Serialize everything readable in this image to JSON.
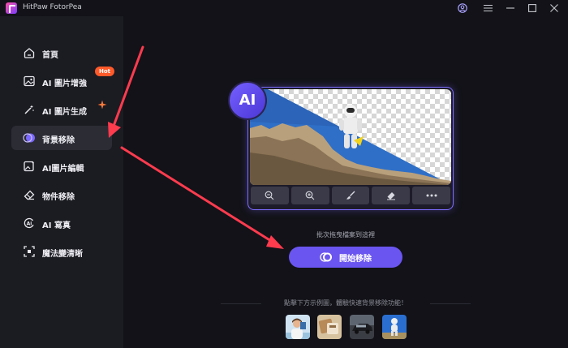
{
  "app": {
    "title": "HitPaw FotorPea"
  },
  "titlebar": {
    "icons": [
      "account-icon",
      "menu-icon",
      "minimize-icon",
      "maximize-icon",
      "close-icon"
    ]
  },
  "sidebar": {
    "items": [
      {
        "label": "首頁",
        "icon": "home-icon"
      },
      {
        "label": "AI 圖片增強",
        "icon": "image-enhance-icon"
      },
      {
        "label": "AI 圖片生成",
        "icon": "magic-wand-icon"
      },
      {
        "label": "背景移除",
        "icon": "background-remove-icon",
        "active": true
      },
      {
        "label": "AI圖片編輯",
        "icon": "image-edit-icon"
      },
      {
        "label": "物件移除",
        "icon": "eraser-icon"
      },
      {
        "label": "AI 寫真",
        "icon": "ai-portrait-icon"
      },
      {
        "label": "魔法變清晰",
        "icon": "sharpen-icon"
      }
    ],
    "hot_badge": "Hot"
  },
  "preview": {
    "badge": "AI",
    "tools": [
      "zoom-out-icon",
      "zoom-in-icon",
      "brush-icon",
      "eraser-icon",
      "more-icon"
    ]
  },
  "upload": {
    "hint": "批次拖曳檔案到這裡",
    "start_label": "開始移除"
  },
  "samples": {
    "hint": "點擊下方示例圖，體驗快速背景移除功能！",
    "items": [
      "sample-portrait",
      "sample-product",
      "sample-car",
      "sample-pet"
    ]
  },
  "colors": {
    "accent": "#6a55f0",
    "hot": "#ff5a2a",
    "arrow": "#ff3b4e"
  }
}
